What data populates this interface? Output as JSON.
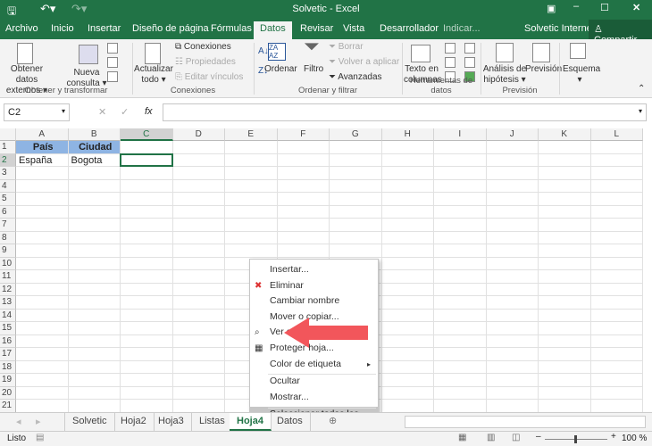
{
  "window": {
    "title": "Solvetic - Excel",
    "accent": "#217346"
  },
  "qat": {
    "save": "save-icon",
    "undo": "undo-icon",
    "redo": "redo-icon"
  },
  "tabs": [
    {
      "label": "Archivo"
    },
    {
      "label": "Inicio"
    },
    {
      "label": "Insertar"
    },
    {
      "label": "Diseño de página"
    },
    {
      "label": "Fórmulas"
    },
    {
      "label": "Datos",
      "active": true
    },
    {
      "label": "Revisar"
    },
    {
      "label": "Vista"
    },
    {
      "label": "Desarrollador"
    },
    {
      "label": "Indicar..."
    }
  ],
  "account": {
    "user": "Solvetic Internet",
    "share": "Compartir"
  },
  "ribbon": {
    "obtener": {
      "l1": "Obtener datos",
      "l2": "externos",
      "group": "Obtener y transformar",
      "nueva1": "Nueva",
      "nueva2": "consulta"
    },
    "conexiones": {
      "act1": "Actualizar",
      "act2": "todo",
      "c1": "Conexiones",
      "c2": "Propiedades",
      "c3": "Editar vínculos",
      "group": "Conexiones"
    },
    "ordenar": {
      "ordenar": "Ordenar",
      "filtro": "Filtro",
      "borrar": "Borrar",
      "volver": "Volver a aplicar",
      "avanzadas": "Avanzadas",
      "group": "Ordenar y filtrar"
    },
    "herr": {
      "t1": "Texto en",
      "t2": "columnas",
      "group": "Herramientas de datos"
    },
    "prev": {
      "a1": "Análisis de",
      "a2": "hipótesis",
      "p": "Previsión",
      "group": "Previsión"
    },
    "esquema": {
      "label": "Esquema"
    }
  },
  "formula_bar": {
    "name_box": "C2",
    "fx": "fx",
    "value": ""
  },
  "grid": {
    "columns": [
      "A",
      "B",
      "C",
      "D",
      "E",
      "F",
      "G",
      "H",
      "I",
      "J",
      "K",
      "L"
    ],
    "rows": 21,
    "cells": {
      "A1": "País",
      "B1": "Ciudad",
      "A2": "España",
      "B2": "Bogota"
    },
    "selected": "C2",
    "header_fill": "#8eb4e3"
  },
  "context_menu": {
    "items": [
      "Insertar...",
      "Eliminar",
      "Cambiar nombre",
      "Mover o copiar...",
      "Ver código",
      "Proteger hoja...",
      "Color de etiqueta",
      "Ocultar",
      "Mostrar...",
      "Seleccionar todas las hojas"
    ],
    "highlighted": "Seleccionar todas las hojas",
    "arrow_color": "#f2565b"
  },
  "sheets": [
    {
      "label": "Solvetic"
    },
    {
      "label": "Hoja2"
    },
    {
      "label": "Hoja3"
    },
    {
      "label": "Listas"
    },
    {
      "label": "Hoja4",
      "active": true
    },
    {
      "label": "Datos"
    }
  ],
  "status": {
    "text": "Listo",
    "zoom": "100 %",
    "zoom_percent": 100
  }
}
